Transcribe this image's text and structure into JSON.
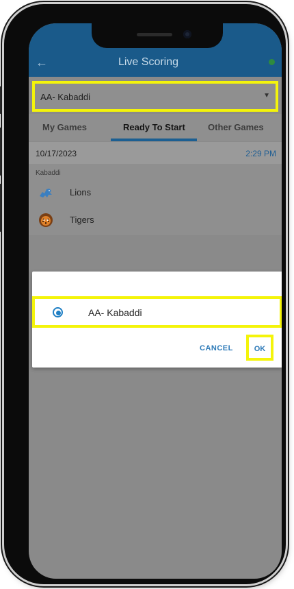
{
  "appbar": {
    "title": "Live Scoring",
    "back_icon": "arrow-left-icon",
    "status_color": "#2e8b3e"
  },
  "sport_select": {
    "value": "AA- Kabaddi"
  },
  "tabs": [
    {
      "label": "My Games",
      "active": false
    },
    {
      "label": "Ready To Start",
      "active": true
    },
    {
      "label": "Other Games",
      "active": false
    }
  ],
  "game": {
    "date": "10/17/2023",
    "time": "2:29 PM",
    "sport": "Kabaddi",
    "teams": [
      {
        "name": "Lions",
        "icon": "lion-logo-icon"
      },
      {
        "name": "Tigers",
        "icon": "tiger-logo-icon"
      }
    ]
  },
  "dialog": {
    "option_label": "AA- Kabaddi",
    "cancel_label": "CANCEL",
    "ok_label": "OK"
  },
  "colors": {
    "appbar": "#1a5a8a",
    "accent": "#1f7fc4",
    "highlight": "#f4f40a"
  }
}
